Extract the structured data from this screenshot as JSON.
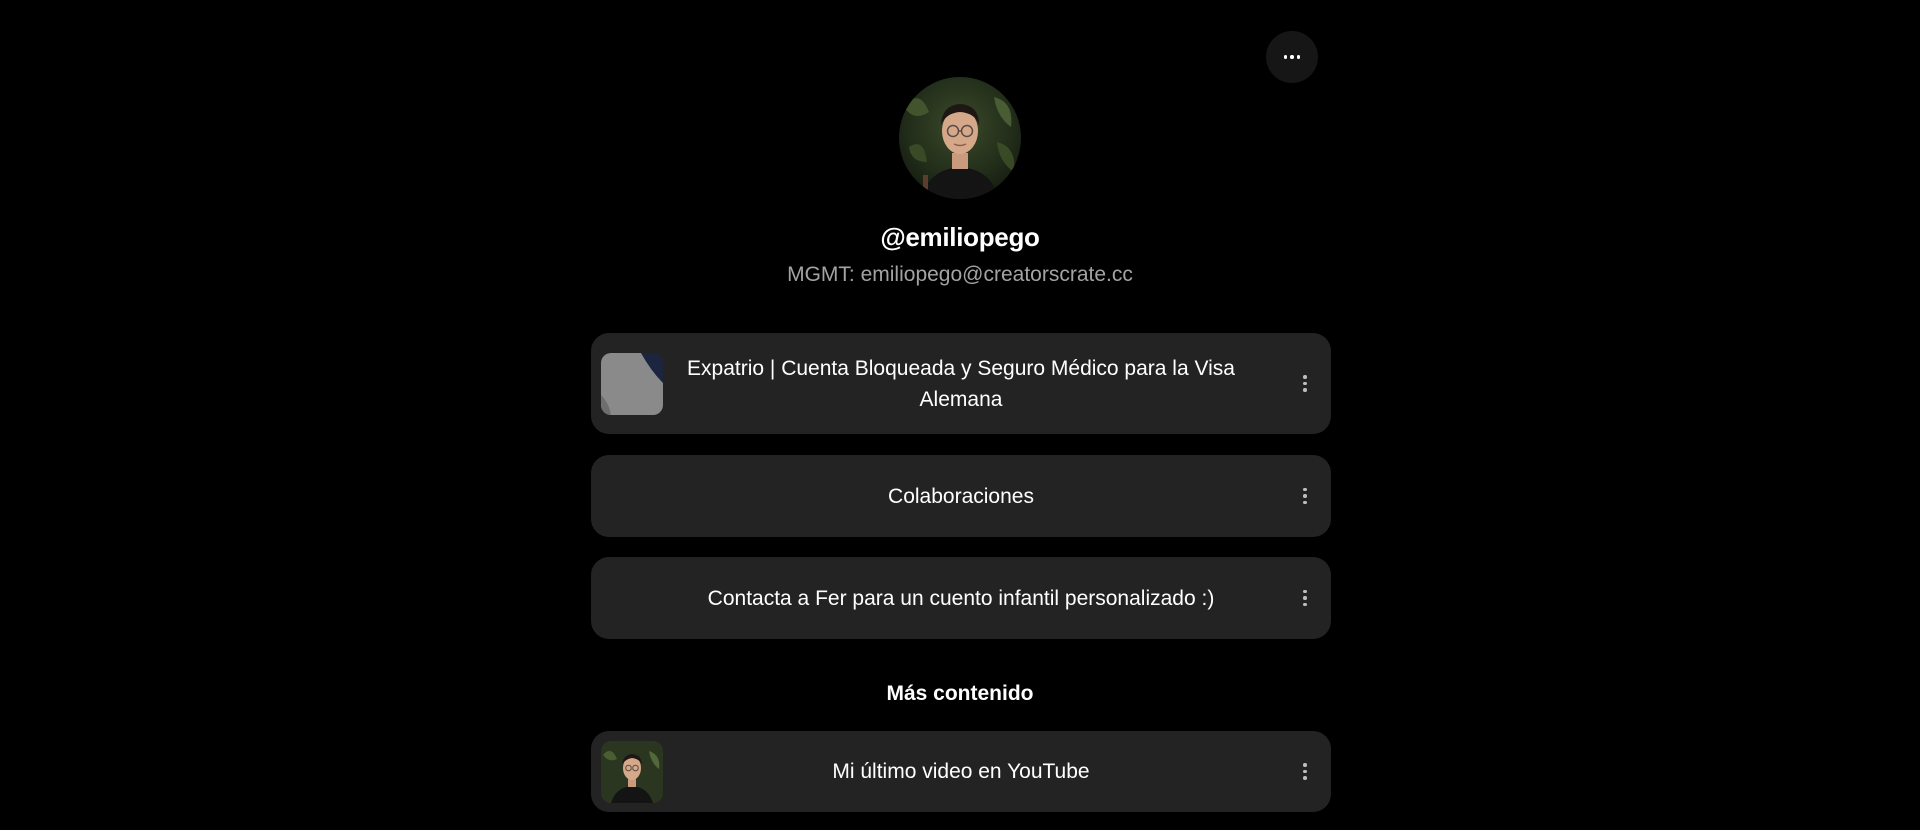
{
  "profile": {
    "handle": "@emiliopego",
    "bio": "MGMT: emiliopego@creatorscrate.cc"
  },
  "header": {
    "more_icon": "ellipsis-horizontal-icon"
  },
  "links": [
    {
      "label": "Expatrio | Cuenta Bloqueada y Seguro Médico para la Visa Alemana",
      "has_thumbnail": true,
      "thumbnail": "expatrio-logo"
    },
    {
      "label": "Colaboraciones",
      "has_thumbnail": false
    },
    {
      "label": "Contacta a Fer para un cuento infantil personalizado :)",
      "has_thumbnail": false
    }
  ],
  "more_content": {
    "heading": "Más contenido",
    "links": [
      {
        "label": "Mi último video en YouTube",
        "has_thumbnail": true,
        "thumbnail": "profile-photo"
      }
    ]
  },
  "colors": {
    "background": "#000000",
    "card": "#232323",
    "bio_text": "#a3a3a3"
  }
}
